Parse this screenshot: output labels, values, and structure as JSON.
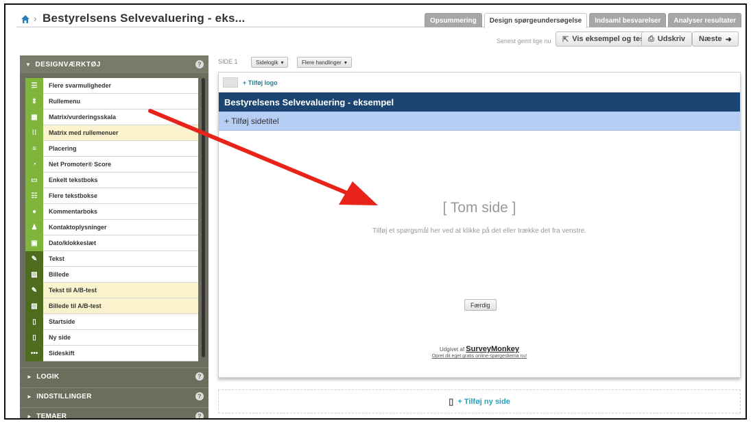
{
  "header": {
    "title": "Bestyrelsens Selvevaluering - eks...",
    "tabs": [
      {
        "label": "Opsummering",
        "active": false
      },
      {
        "label": "Design spørgeundersøgelse",
        "active": true
      },
      {
        "label": "Indsaml besvarelser",
        "active": false
      },
      {
        "label": "Analyser resultater",
        "active": false
      }
    ],
    "saved_text": "Senest gemt lige nu",
    "preview_button": "Vis eksempel og test",
    "print_button": "Udskriv",
    "next_button": "Næste"
  },
  "panel": {
    "design_tools_title": "DESIGNVÆRKTØJ",
    "tools": [
      {
        "label": "Flere svarmuligheder",
        "highlight": false,
        "icon": "list-icon"
      },
      {
        "label": "Rullemenu",
        "highlight": false,
        "icon": "dropdown-icon"
      },
      {
        "label": "Matrix/vurderingsskala",
        "highlight": false,
        "icon": "grid-icon"
      },
      {
        "label": "Matrix med rullemenuer",
        "highlight": true,
        "icon": "matrix-dropdown-icon"
      },
      {
        "label": "Placering",
        "highlight": false,
        "icon": "ranking-icon"
      },
      {
        "label": "Net Promoter® Score",
        "highlight": false,
        "icon": "gauge-icon"
      },
      {
        "label": "Enkelt tekstboks",
        "highlight": false,
        "icon": "textbox-icon"
      },
      {
        "label": "Flere tekstbokse",
        "highlight": false,
        "icon": "textboxes-icon"
      },
      {
        "label": "Kommentarboks",
        "highlight": false,
        "icon": "comment-icon"
      },
      {
        "label": "Kontaktoplysninger",
        "highlight": false,
        "icon": "person-icon"
      },
      {
        "label": "Dato/klokkeslæt",
        "highlight": false,
        "icon": "calendar-icon"
      },
      {
        "label": "Tekst",
        "highlight": false,
        "icon": "edit-icon"
      },
      {
        "label": "Billede",
        "highlight": false,
        "icon": "image-icon"
      },
      {
        "label": "Tekst til A/B-test",
        "highlight": true,
        "icon": "edit-icon"
      },
      {
        "label": "Billede til A/B-test",
        "highlight": true,
        "icon": "image-icon"
      },
      {
        "label": "Startside",
        "highlight": false,
        "icon": "page-icon"
      },
      {
        "label": "Ny side",
        "highlight": false,
        "icon": "page-icon"
      },
      {
        "label": "Sideskift",
        "highlight": false,
        "icon": "ellipsis-icon"
      }
    ],
    "sections": [
      "LOGIK",
      "INDSTILLINGER",
      "TEMAER"
    ]
  },
  "main": {
    "page_label": "SIDE 1",
    "page_logic_button": "Sidelogik",
    "more_actions_button": "Flere handlinger",
    "add_logo": "+ Tilføj logo",
    "survey_title": "Bestyrelsens Selvevaluering - eksempel",
    "add_page_title": "+ Tilføj sidetitel",
    "empty_title": "[ Tom side ]",
    "empty_hint": "Tilføj et spørgsmål her ved at klikke på det eller trække det fra venstre.",
    "done_button": "Færdig",
    "published_by": "Udgivet af",
    "brand": "SurveyMonkey",
    "create_own": "Opret dit eget gratis online-spørgeskema nu!",
    "add_new_page": "+ Tilføj ny side"
  },
  "colors": {
    "accent_green": "#7fb53b",
    "panel": "#6d6d5e",
    "survey_bar": "#1b4470",
    "arrow": "#e8231a"
  }
}
